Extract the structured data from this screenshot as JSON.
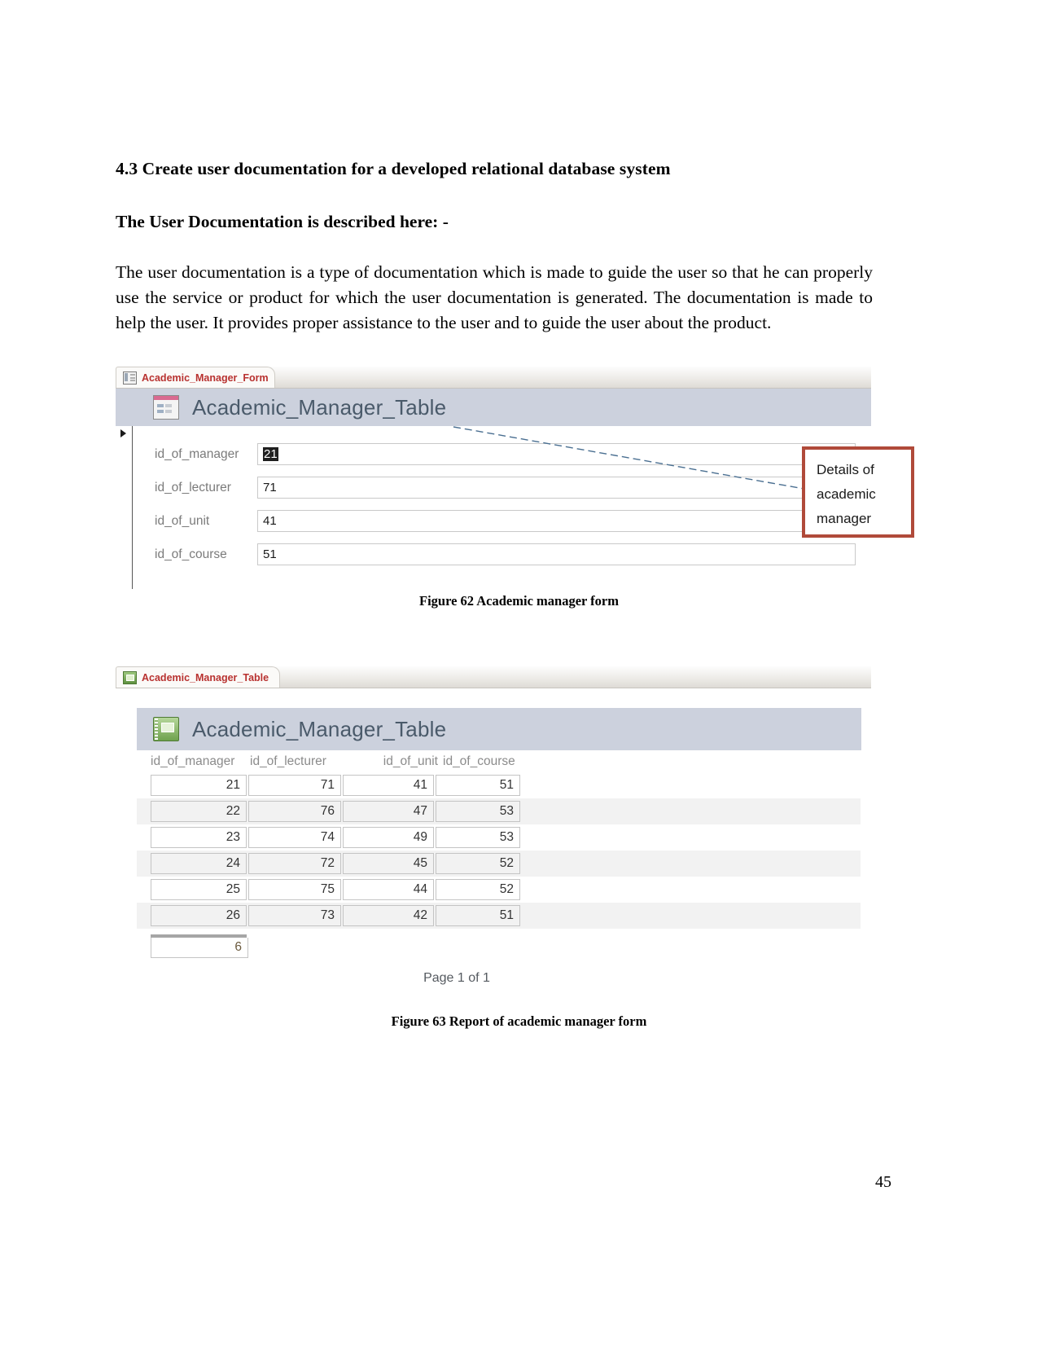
{
  "document": {
    "section_heading": "4.3 Create user documentation for a developed relational database system",
    "sub_heading": "The User Documentation is described here: -",
    "paragraph": "The user documentation is a type of documentation which is made to guide the user so that he can properly use the service or product for which the user documentation is generated. The documentation is made to help the user. It provides proper assistance to the user and to guide the user about the product.",
    "page_number": "45"
  },
  "figure62": {
    "caption": "Figure 62 Academic manager form",
    "tab": {
      "label": "Academic_Manager_Form",
      "icon": "form-icon"
    },
    "header": {
      "title": "Academic_Manager_Table",
      "icon": "form-header-icon"
    },
    "record_selector_icon": "record-selector-arrow-icon",
    "fields": [
      {
        "label": "id_of_manager",
        "value": "21",
        "selected": true
      },
      {
        "label": "id_of_lecturer",
        "value": "71",
        "selected": false
      },
      {
        "label": "id_of_unit",
        "value": "41",
        "selected": false
      },
      {
        "label": "id_of_course",
        "value": "51",
        "selected": false
      }
    ],
    "callout": {
      "lines": [
        "Details of",
        "academic",
        "manager"
      ],
      "border_color": "#b04a3a"
    }
  },
  "figure63": {
    "caption": "Figure 63 Report of academic manager form",
    "tab": {
      "label": "Academic_Manager_Table",
      "icon": "table-icon"
    },
    "header": {
      "title": "Academic_Manager_Table",
      "icon": "table-header-icon"
    },
    "table": {
      "columns": [
        "id_of_manager",
        "id_of_lecturer",
        "id_of_unit",
        "id_of_course"
      ],
      "rows": [
        [
          "21",
          "71",
          "41",
          "51"
        ],
        [
          "22",
          "76",
          "47",
          "53"
        ],
        [
          "23",
          "74",
          "49",
          "53"
        ],
        [
          "24",
          "72",
          "45",
          "52"
        ],
        [
          "25",
          "75",
          "44",
          "52"
        ],
        [
          "26",
          "73",
          "42",
          "51"
        ]
      ],
      "total": "6"
    },
    "page_footer": "Page 1 of 1"
  }
}
